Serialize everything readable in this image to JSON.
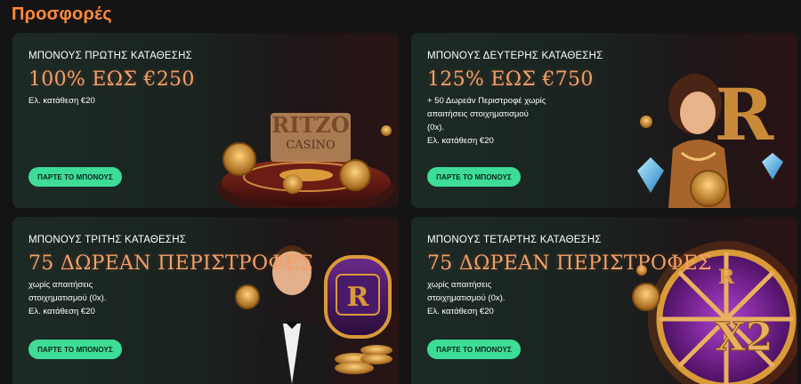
{
  "page": {
    "title": "Προσφορές"
  },
  "offers": [
    {
      "heading": "ΜΠΟΝΟΥΣ ΠΡΩΤΗΣ ΚΑΤΑΘΕΣΗΣ",
      "amount": "100% ΕΩΣ €250",
      "details": [
        "Ελ. κατάθεση €20"
      ],
      "button": "ΠΑΡΤΕ ΤΟ ΜΠΟΝΟΥΣ",
      "art_text": [
        "RITZO",
        "CASINO"
      ]
    },
    {
      "heading": "ΜΠΟΝΟΥΣ ΔΕΥΤΕΡΗΣ ΚΑΤΑΘΕΣΗΣ",
      "amount": "125% ΕΩΣ €750",
      "details": [
        "+ 50 Δωρεάν Περιστροφέ χωρίς",
        "απαιτήσεις στοιχηματισμού",
        "(0x).",
        "Ελ. κατάθεση €20"
      ],
      "button": "ΠΑΡΤΕ ΤΟ ΜΠΟΝΟΥΣ",
      "art_text": [
        "R"
      ]
    },
    {
      "heading": "ΜΠΟΝΟΥΣ ΤΡΙΤΗΣ ΚΑΤΑΘΕΣΗΣ",
      "amount": "75 ΔΩΡΕΑΝ ΠΕΡΙΣΤΡΟΦΕΣ",
      "details": [
        "χωρίς απαιτήσεις",
        "στοιχηματισμού (0x).",
        "Ελ. κατάθεση €20"
      ],
      "button": "ΠΑΡΤΕ ΤΟ ΜΠΟΝΟΥΣ",
      "art_text": [
        "R"
      ]
    },
    {
      "heading": "ΜΠΟΝΟΥΣ ΤΕΤΑΡΤΗΣ ΚΑΤΑΘΕΣΗΣ",
      "amount": "75 ΔΩΡΕΑΝ ΠΕΡΙΣΤΡΟΦΕΣ",
      "details": [
        "χωρίς απαιτήσεις",
        "στοιχηματισμού (0x).",
        "Ελ. κατάθεση €20"
      ],
      "button": "ΠΑΡΤΕ ΤΟ ΜΠΟΝΟΥΣ",
      "art_text": [
        "R",
        "X2"
      ]
    }
  ],
  "colors": {
    "accent": "#ff8a3d",
    "amount": "#f2a06a",
    "button": "#3ddc97",
    "gold": "#d99a3a"
  }
}
